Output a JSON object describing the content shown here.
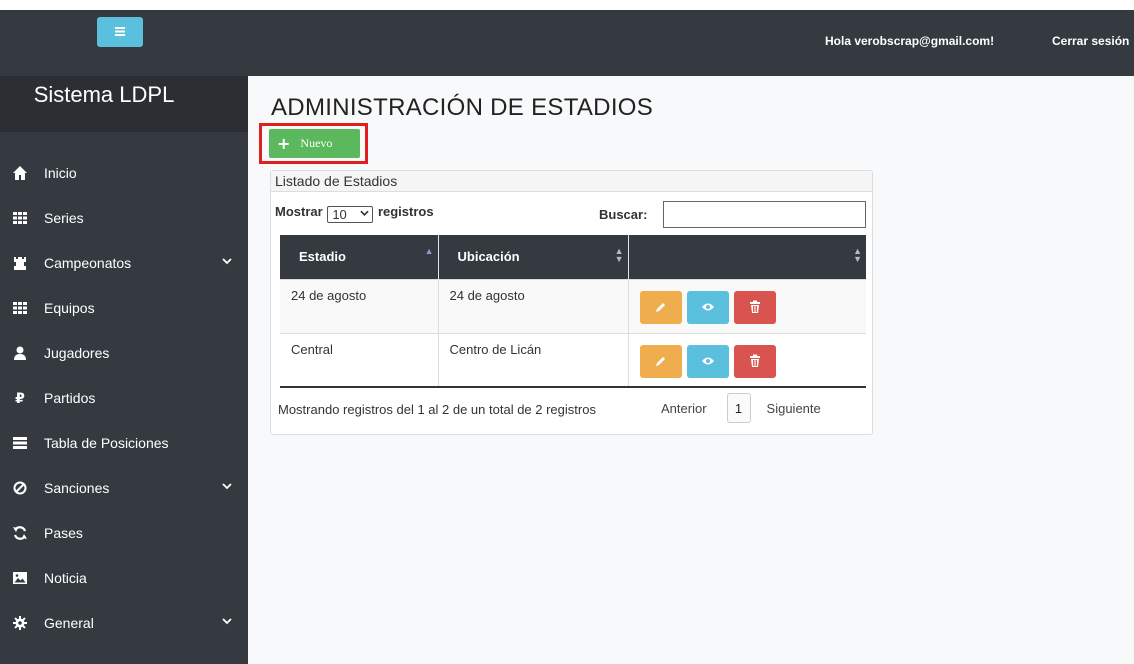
{
  "topbar": {
    "menu_icon": "hamburger-icon",
    "greeting": "Hola verobscrap@gmail.com!",
    "logout": "Cerrar sesión"
  },
  "sidebar": {
    "brand": "Sistema LDPL",
    "items": [
      {
        "label": "Inicio",
        "icon": "home-icon",
        "has_submenu": false
      },
      {
        "label": "Series",
        "icon": "grid-icon",
        "has_submenu": false
      },
      {
        "label": "Campeonatos",
        "icon": "rook-icon",
        "has_submenu": true
      },
      {
        "label": "Equipos",
        "icon": "grid-icon",
        "has_submenu": false
      },
      {
        "label": "Jugadores",
        "icon": "user-icon",
        "has_submenu": false
      },
      {
        "label": "Partidos",
        "icon": "ruble-icon",
        "has_submenu": false
      },
      {
        "label": "Tabla de Posiciones",
        "icon": "list-icon",
        "has_submenu": false
      },
      {
        "label": "Sanciones",
        "icon": "ban-icon",
        "has_submenu": true
      },
      {
        "label": "Pases",
        "icon": "refresh-icon",
        "has_submenu": false
      },
      {
        "label": "Noticia",
        "icon": "image-icon",
        "has_submenu": false
      },
      {
        "label": "General",
        "icon": "gear-icon",
        "has_submenu": true
      }
    ]
  },
  "main": {
    "title": "ADMINISTRACIÓN DE ESTADIOS",
    "new_button": "Nuevo",
    "panel_title": "Listado de Estadios",
    "length_prefix": "Mostrar",
    "length_value": "10",
    "length_suffix": "registros",
    "search_label": "Buscar:",
    "search_value": "",
    "columns": [
      "Estadio",
      "Ubicación",
      ""
    ],
    "rows": [
      {
        "estadio": "24 de agosto",
        "ubicacion": "24 de agosto"
      },
      {
        "estadio": "Central",
        "ubicacion": "Centro de Licán"
      }
    ],
    "info": "Mostrando registros del 1 al 2 de un total de 2 registros",
    "pager": {
      "prev": "Anterior",
      "page": "1",
      "next": "Siguiente"
    }
  },
  "colors": {
    "sidebar": "#343a40",
    "new_button": "#5cb85c",
    "highlight_box": "#e01f1f",
    "edit": "#f0ad4e",
    "view": "#5bc0de",
    "delete": "#d9534f"
  }
}
